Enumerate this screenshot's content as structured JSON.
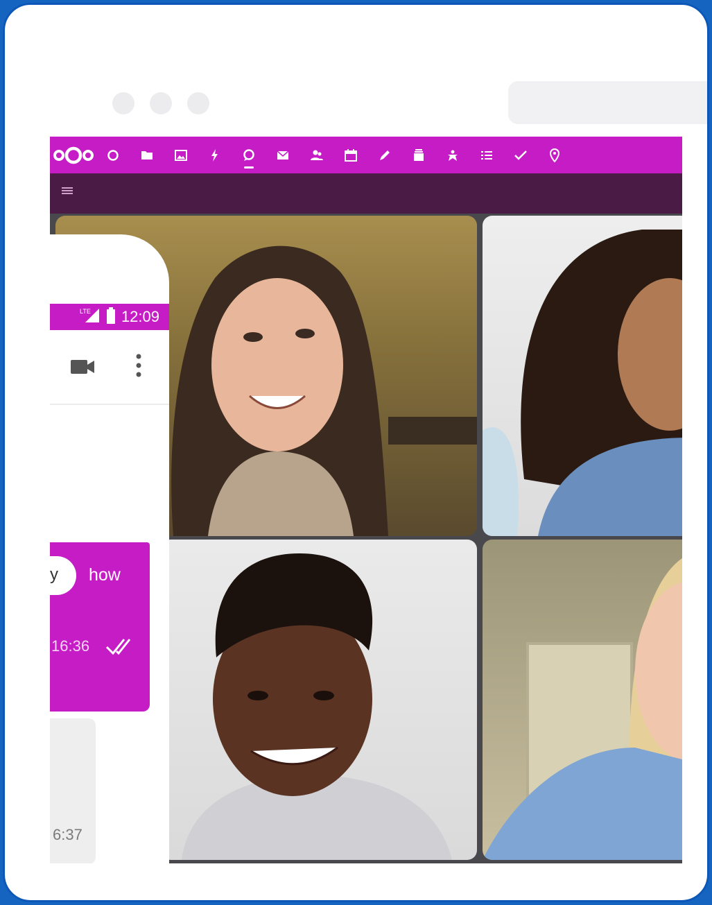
{
  "colors": {
    "brand": "#c61cc6",
    "header_dark": "#4a1b45",
    "frame_border": "#1565c0"
  },
  "window": {
    "dots": [
      "dot",
      "dot",
      "dot"
    ]
  },
  "topbar": {
    "logo": "nextcloud-logo",
    "apps": [
      {
        "icon": "dashboard-icon",
        "active": false
      },
      {
        "icon": "files-icon",
        "active": false
      },
      {
        "icon": "photos-icon",
        "active": false
      },
      {
        "icon": "activity-icon",
        "active": false
      },
      {
        "icon": "talk-icon",
        "active": true
      },
      {
        "icon": "mail-icon",
        "active": false
      },
      {
        "icon": "contacts-icon",
        "active": false
      },
      {
        "icon": "calendar-icon",
        "active": false
      },
      {
        "icon": "notes-icon",
        "active": false
      },
      {
        "icon": "deck-icon",
        "active": false
      },
      {
        "icon": "circles-icon",
        "active": false
      },
      {
        "icon": "list-icon",
        "active": false
      },
      {
        "icon": "tasks-icon",
        "active": false
      },
      {
        "icon": "maps-icon",
        "active": false
      }
    ]
  },
  "video_call": {
    "participants": [
      "participant-1",
      "participant-2",
      "participant-3",
      "participant-4"
    ]
  },
  "phone": {
    "status": {
      "network": "LTE",
      "time": "12:09"
    },
    "chat": {
      "incoming_fragment": "y",
      "own_message": "how",
      "own_timestamp": "16:36",
      "reply_timestamp": "6:37"
    }
  }
}
